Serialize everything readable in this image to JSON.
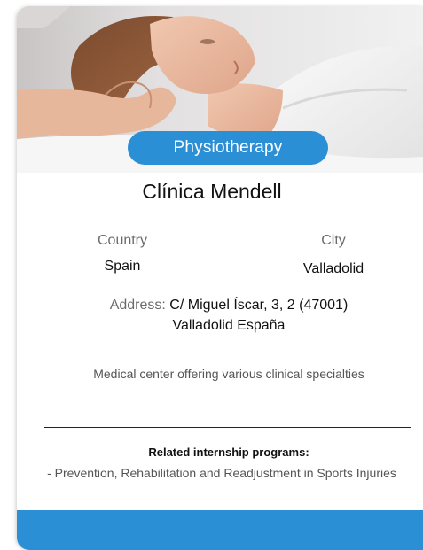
{
  "card": {
    "category": "Physiotherapy",
    "name": "Clínica Mendell",
    "country_label": "Country",
    "country_value": "Spain",
    "city_label": "City",
    "city_value": "Valladolid",
    "address_label": "Address:",
    "address_line1": "C/ Miguel Íscar, 3, 2  (47001)",
    "address_line2": "Valladolid España",
    "description": "Medical center offering various clinical specialties",
    "related_title": "Related internship programs:",
    "related_programs": [
      "- Prevention, Rehabilitation and Readjustment in Sports Injuries"
    ]
  },
  "colors": {
    "accent": "#2b8fd6",
    "text": "#111111",
    "muted": "#6b6b6b"
  }
}
